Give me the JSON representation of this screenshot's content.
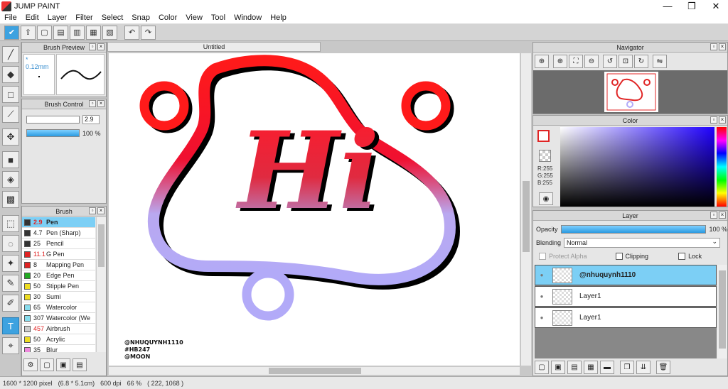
{
  "window": {
    "title": "JUMP PAINT",
    "minimize": "—",
    "maximize": "❐",
    "close": "✕"
  },
  "menu": [
    "File",
    "Edit",
    "Layer",
    "Filter",
    "Select",
    "Snap",
    "Color",
    "View",
    "Tool",
    "Window",
    "Help"
  ],
  "brush_preview": {
    "title": "Brush Preview",
    "size": "* 0.12mm"
  },
  "brush_control": {
    "title": "Brush Control",
    "size_value": "2.9",
    "opacity_value": "100 %"
  },
  "brush": {
    "title": "Brush",
    "items": [
      {
        "num": "2.9",
        "name": "Pen",
        "color": "#333333",
        "red": true,
        "selected": true
      },
      {
        "num": "4.7",
        "name": "Pen (Sharp)",
        "color": "#333333",
        "red": false,
        "selected": false
      },
      {
        "num": "25",
        "name": "Pencil",
        "color": "#333333",
        "red": false,
        "selected": false
      },
      {
        "num": "11.1",
        "name": "G Pen",
        "color": "#e02424",
        "red": true,
        "selected": false
      },
      {
        "num": "8",
        "name": "Mapping Pen",
        "color": "#e02424",
        "red": false,
        "selected": false
      },
      {
        "num": "20",
        "name": "Edge Pen",
        "color": "#22aa22",
        "red": false,
        "selected": false
      },
      {
        "num": "50",
        "name": "Stipple Pen",
        "color": "#eedd22",
        "red": false,
        "selected": false
      },
      {
        "num": "30",
        "name": "Sumi",
        "color": "#eedd22",
        "red": false,
        "selected": false
      },
      {
        "num": "65",
        "name": "Watercolor",
        "color": "#88ddee",
        "red": false,
        "selected": false
      },
      {
        "num": "307",
        "name": "Watercolor (We",
        "color": "#88ddee",
        "red": false,
        "selected": false
      },
      {
        "num": "457",
        "name": "Airbrush",
        "color": "#cccccc",
        "red": true,
        "selected": false
      },
      {
        "num": "50",
        "name": "Acrylic",
        "color": "#eedd22",
        "red": false,
        "selected": false
      },
      {
        "num": "35",
        "name": "Blur",
        "color": "#ee88dd",
        "red": false,
        "selected": false
      }
    ]
  },
  "canvas": {
    "tab": "Untitled",
    "greeting": "Hi",
    "signature": [
      "@NHUQUYNH1110",
      "#HB247",
      "@MOON"
    ]
  },
  "navigator": {
    "title": "Navigator"
  },
  "color": {
    "title": "Color",
    "r": "R:255",
    "g": "G:255",
    "b": "B:255",
    "accent": "#e02424"
  },
  "layer": {
    "title": "Layer",
    "opacity_label": "Opacity",
    "opacity_value": "100 %",
    "blending_label": "Blending",
    "blending_value": "Normal",
    "protect_alpha": "Protect Alpha",
    "clipping": "Clipping",
    "lock": "Lock",
    "items": [
      {
        "name": "@nhuquynh1110",
        "selected": true
      },
      {
        "name": "Layer1",
        "selected": false
      },
      {
        "name": "Layer1",
        "selected": false
      }
    ]
  },
  "status": {
    "pixels": "1600 * 1200 pixel",
    "size": "(6.8 * 5.1cm)",
    "dpi": "600 dpi",
    "zoom": "66 %",
    "coords": "( 222, 1068 )"
  }
}
